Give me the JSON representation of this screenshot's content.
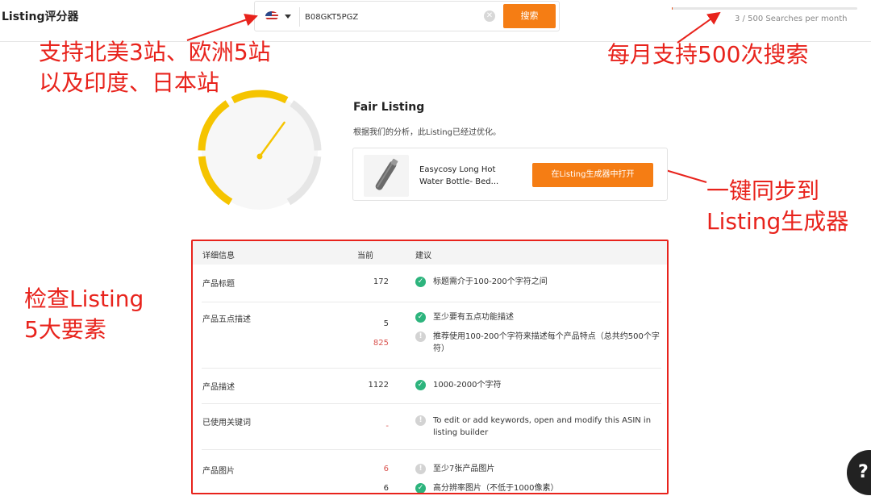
{
  "app": {
    "title": "Listing评分器"
  },
  "search": {
    "marketplace": "US",
    "asin": "B08GKT5PGZ",
    "button_label": "搜索"
  },
  "usage": {
    "used": 3,
    "limit": 500,
    "text": "3 / 500 Searches per month"
  },
  "annotations": {
    "markets": [
      "支持北美3站、欧洲5站",
      "以及印度、日本站"
    ],
    "monthly": "每月支持500次搜索",
    "sync": [
      "一键同步到",
      "Listing生成器"
    ],
    "check": [
      "检查Listing",
      "5大要素"
    ]
  },
  "score": {
    "title": "Fair Listing",
    "description": "根据我们的分析，此Listing已经过优化。",
    "gauge_level": 0.62,
    "gauge_color": "#f5c400"
  },
  "product": {
    "name": "Easycosy Long Hot Water Bottle- Bed...",
    "open_button_label": "在Listing生成器中打开"
  },
  "details": {
    "headers": {
      "detail": "详细信息",
      "current": "当前",
      "suggestion": "建议"
    },
    "rows": [
      {
        "name": "产品标题",
        "values": [
          {
            "text": "172",
            "status": "ok"
          }
        ],
        "suggestions": [
          {
            "icon": "ok",
            "text": "标题需介于100-200个字符之间"
          }
        ]
      },
      {
        "name": "产品五点描述",
        "values": [
          {
            "text": "5",
            "status": "ok"
          },
          {
            "text": "825",
            "status": "warn"
          }
        ],
        "suggestions": [
          {
            "icon": "ok",
            "text": "至少要有五点功能描述"
          },
          {
            "icon": "info",
            "text": "推荐使用100-200个字符来描述每个产品特点（总共约500个字符）"
          }
        ]
      },
      {
        "name": "产品描述",
        "values": [
          {
            "text": "1122",
            "status": "ok"
          }
        ],
        "suggestions": [
          {
            "icon": "ok",
            "text": "1000-2000个字符"
          }
        ]
      },
      {
        "name": "已使用关键词",
        "values": [
          {
            "text": "-",
            "status": "warn"
          }
        ],
        "suggestions": [
          {
            "icon": "info",
            "text": "To edit or add keywords, open and modify this ASIN in listing builder"
          }
        ]
      },
      {
        "name": "产品图片",
        "values": [
          {
            "text": "6",
            "status": "warn"
          },
          {
            "text": "6",
            "status": "ok"
          }
        ],
        "suggestions": [
          {
            "icon": "info",
            "text": "至少7张产品图片"
          },
          {
            "icon": "ok",
            "text": "高分辨率图片（不低于1000像素）"
          }
        ]
      }
    ]
  },
  "colors": {
    "accent": "#f57d14",
    "annotation": "#e8231c",
    "ok": "#2db47d",
    "warn": "#d9534f"
  }
}
